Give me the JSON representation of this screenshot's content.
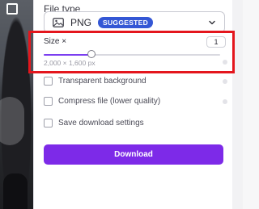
{
  "export_panel": {
    "file_type_title": "File type",
    "file_type_value": "PNG",
    "file_type_badge": "SUGGESTED",
    "size_label": "Size ×",
    "size_value": "1",
    "size_slider_fraction": 0.27,
    "dimensions": "2,000 × 1,600 px",
    "options": [
      {
        "label": "Transparent background",
        "checked": false
      },
      {
        "label": "Compress file (lower quality)",
        "checked": false
      },
      {
        "label": "Save download settings",
        "checked": false
      }
    ],
    "download_label": "Download"
  },
  "colors": {
    "accent": "#7d2ae8",
    "badge": "#3457d5",
    "highlight": "#e4161d"
  },
  "icons": {
    "file_type": "image-icon",
    "dropdown": "chevron-down-icon",
    "pro_marker": "crown-icon"
  }
}
